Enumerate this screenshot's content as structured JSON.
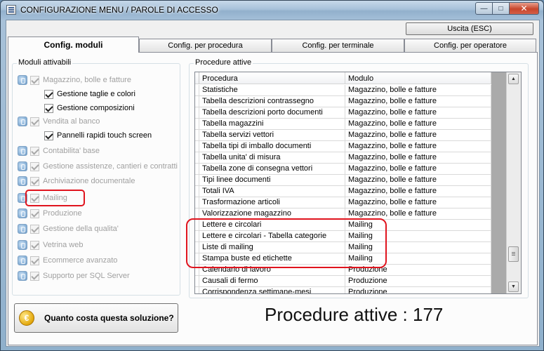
{
  "window": {
    "title": "CONFIGURAZIONE MENU / PAROLE DI ACCESSO",
    "minimize_glyph": "—",
    "maximize_glyph": "□",
    "close_glyph": "✕"
  },
  "toolbar": {
    "exit_label": "Uscita (ESC)"
  },
  "tabs": [
    {
      "label": "Config. moduli",
      "active": true
    },
    {
      "label": "Config. per procedura",
      "active": false
    },
    {
      "label": "Config. per terminale",
      "active": false
    },
    {
      "label": "Config. per operatore",
      "active": false
    }
  ],
  "modules": {
    "title": "Moduli attivabili",
    "items": [
      {
        "label": "Magazzino, bolle e fatture",
        "enabled": false,
        "icon": "module-icon",
        "checked": true
      },
      {
        "label": "Gestione taglie e colori",
        "enabled": true,
        "checked": true,
        "sub": true
      },
      {
        "label": "Gestione composizioni",
        "enabled": true,
        "checked": true,
        "sub": true
      },
      {
        "label": "Vendita al banco",
        "enabled": false,
        "icon": "module-icon",
        "checked": true
      },
      {
        "label": "Pannelli rapidi touch screen",
        "enabled": true,
        "checked": true,
        "sub": true
      },
      {
        "label": "Contabilita' base",
        "enabled": false,
        "icon": "module-icon",
        "checked": true
      },
      {
        "label": "Gestione assistenze, cantieri e contratti",
        "enabled": false,
        "icon": "module-icon",
        "checked": true
      },
      {
        "label": "Archiviazione documentale",
        "enabled": false,
        "icon": "module-icon",
        "checked": true
      },
      {
        "label": "Mailing",
        "enabled": false,
        "icon": "module-icon",
        "checked": true
      },
      {
        "label": "Produzione",
        "enabled": false,
        "icon": "module-icon",
        "checked": true
      },
      {
        "label": "Gestione della qualita'",
        "enabled": false,
        "icon": "module-icon",
        "checked": true
      },
      {
        "label": "Vetrina web",
        "enabled": false,
        "icon": "module-icon",
        "checked": true
      },
      {
        "label": "Ecommerce avanzato",
        "enabled": false,
        "icon": "module-icon",
        "checked": true
      },
      {
        "label": "Supporto per SQL Server",
        "enabled": false,
        "icon": "module-icon",
        "checked": true
      }
    ]
  },
  "cost_button": {
    "label": "Quanto costa questa soluzione?",
    "icon_glyph": "€"
  },
  "procedures": {
    "title": "Procedure attive",
    "columns": [
      "Procedura",
      "Modulo"
    ],
    "rows": [
      [
        "Statistiche",
        "Magazzino, bolle e fatture"
      ],
      [
        "Tabella descrizioni contrassegno",
        "Magazzino, bolle e fatture"
      ],
      [
        "Tabella descrizioni porto documenti",
        "Magazzino, bolle e fatture"
      ],
      [
        "Tabella magazzini",
        "Magazzino, bolle e fatture"
      ],
      [
        "Tabella servizi vettori",
        "Magazzino, bolle e fatture"
      ],
      [
        "Tabella tipi di imballo documenti",
        "Magazzino, bolle e fatture"
      ],
      [
        "Tabella unita' di misura",
        "Magazzino, bolle e fatture"
      ],
      [
        "Tabella zone di consegna vettori",
        "Magazzino, bolle e fatture"
      ],
      [
        "Tipi linee documenti",
        "Magazzino, bolle e fatture"
      ],
      [
        "Totali IVA",
        "Magazzino, bolle e fatture"
      ],
      [
        "Trasformazione articoli",
        "Magazzino, bolle e fatture"
      ],
      [
        "Valorizzazione magazzino",
        "Magazzino, bolle e fatture"
      ],
      [
        "Lettere e circolari",
        "Mailing"
      ],
      [
        "Lettere e circolari - Tabella categorie",
        "Mailing"
      ],
      [
        "Liste di mailing",
        "Mailing"
      ],
      [
        "Stampa buste ed etichette",
        "Mailing"
      ],
      [
        "Calendario di lavoro",
        "Produzione"
      ],
      [
        "Causali di fermo",
        "Produzione"
      ],
      [
        "Corrispondenza settimane-mesi",
        "Produzione"
      ]
    ],
    "counter_text": "Procedure attive : 177",
    "scroll_up_glyph": "▲",
    "scroll_down_glyph": "▼"
  }
}
